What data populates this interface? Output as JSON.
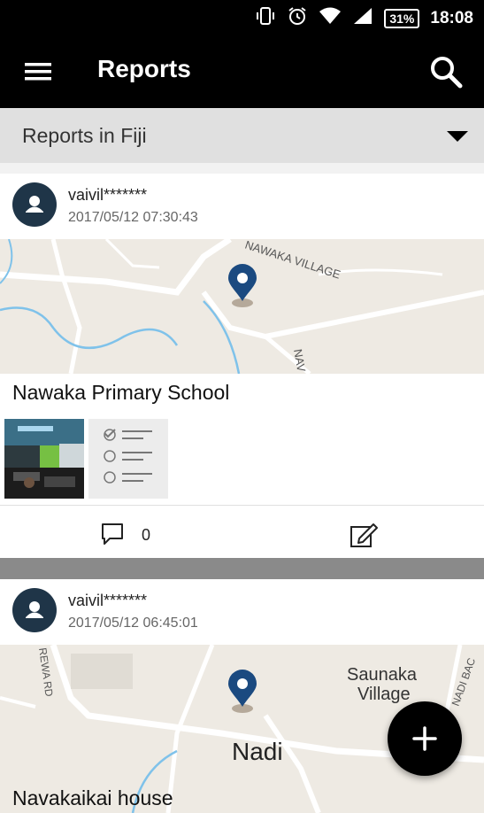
{
  "statusbar": {
    "battery": "31%",
    "time": "18:08"
  },
  "appbar": {
    "title": "Reports"
  },
  "filter": {
    "label": "Reports in Fiji"
  },
  "reports": [
    {
      "user": "vaivil*******",
      "timestamp": "2017/05/12 07:30:43",
      "map_labels": [
        "NAWAKA VILLAGE",
        "NAV"
      ],
      "place": "Nawaka Primary School",
      "comments": "0"
    },
    {
      "user": "vaivil*******",
      "timestamp": "2017/05/12 06:45:01",
      "map_labels": [
        "Saunaka",
        "Village",
        "Nadi",
        "REWA RD",
        "NADI BAC"
      ],
      "place": "Navakaikai house"
    }
  ],
  "colors": {
    "bar": "#000000",
    "avatar": "#1f3548",
    "pin": "#1b4a80",
    "map_bg": "#eeeae3",
    "water": "#7fc2ea"
  },
  "icons": [
    "menu-icon",
    "search-icon",
    "chevron-down-icon",
    "person-icon",
    "map-pin-icon",
    "checklist-icon",
    "comment-icon",
    "edit-icon",
    "plus-icon",
    "vibrate-icon",
    "alarm-icon",
    "wifi-icon",
    "signal-icon"
  ]
}
